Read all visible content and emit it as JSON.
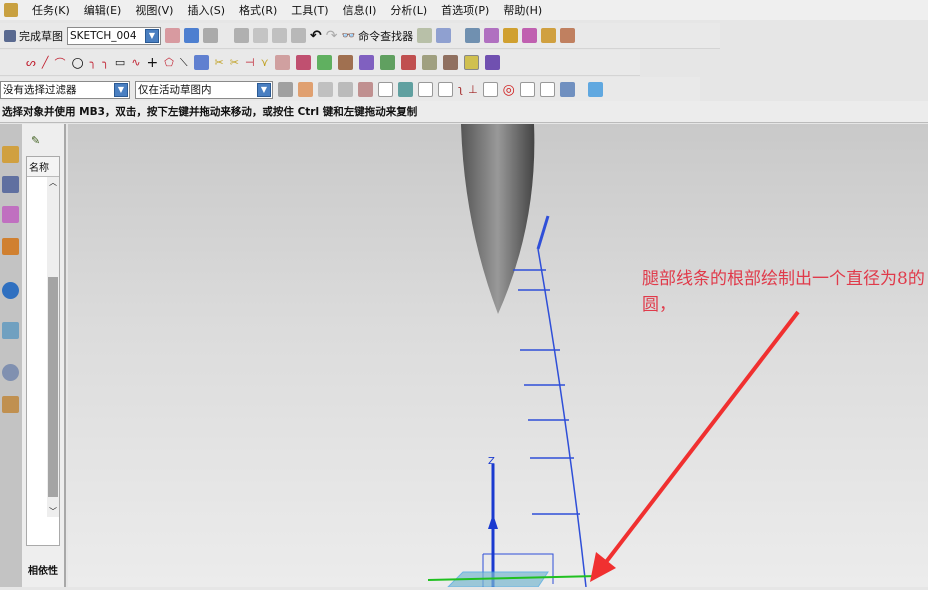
{
  "menu": [
    "任务(K)",
    "编辑(E)",
    "视图(V)",
    "插入(S)",
    "格式(R)",
    "工具(T)",
    "信息(I)",
    "分析(L)",
    "首选项(P)",
    "帮助(H)"
  ],
  "toolbar": {
    "finish_sketch": "完成草图",
    "sketch_name": "SKETCH_004",
    "command_finder": "命令查找器"
  },
  "filters": {
    "selection_filter": "没有选择过滤器",
    "scope": "仅在活动草图内"
  },
  "status": "选择对象并使用 MB3，双击，按下左键并拖动来移动，或按住 Ctrl 键和左键拖动来复制",
  "navigator": {
    "column_name": "名称",
    "dependencies": "相依性"
  },
  "annotation": "腿部线条的根部绘制出一个直径为8的圆，",
  "axis_label": "Z",
  "colors": {
    "annotation": "#e03a4a",
    "sketch_curve": "#2f4fd8",
    "arrow": "#f03030"
  }
}
